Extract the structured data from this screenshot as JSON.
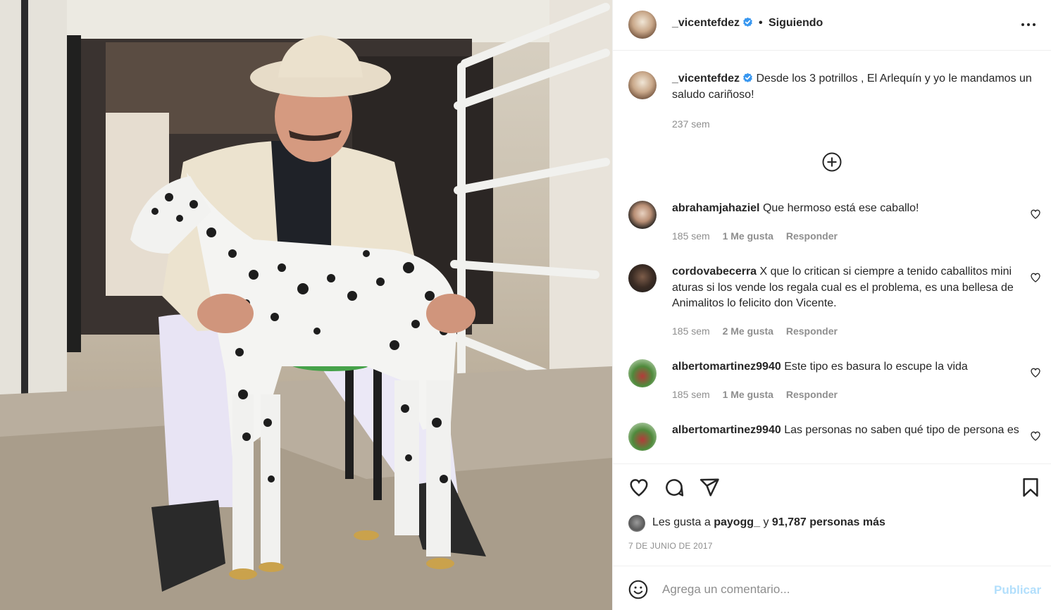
{
  "header": {
    "username": "_vicentefdez",
    "separator": "•",
    "follow_status": "Siguiendo"
  },
  "caption": {
    "username": "_vicentefdez",
    "text": "Desde los 3 potrillos , El Arlequín y yo le mandamos un saludo cariñoso!",
    "time": "237 sem"
  },
  "comments": [
    {
      "username": "abrahamjahaziel",
      "text": "Que hermoso está ese caballo!",
      "time": "185 sem",
      "likes": "1 Me gusta",
      "reply": "Responder"
    },
    {
      "username": "cordovabecerra",
      "text": "X que lo critican si ciempre a tenido caballitos mini aturas si los vende los regala cual es el problema, es una bellesa de Animalitos lo felicito don Vicente.",
      "time": "185 sem",
      "likes": "2 Me gusta",
      "reply": "Responder"
    },
    {
      "username": "albertomartinez9940",
      "text": "Este tipo es basura lo escupe la vida",
      "time": "185 sem",
      "likes": "1 Me gusta",
      "reply": "Responder"
    },
    {
      "username": "albertomartinez9940",
      "text": "Las personas no saben qué tipo de persona es"
    }
  ],
  "likes": {
    "prefix": "Les gusta a",
    "user": "payogg_",
    "joiner": "y",
    "count_text": "91,787 personas más"
  },
  "date": "7 DE JUNIO DE 2017",
  "add_comment": {
    "placeholder": "Agrega un comentario...",
    "publish_label": "Publicar"
  },
  "colors": {
    "verified": "#3897f0",
    "publish_disabled": "#b2dffc",
    "meta": "#8e8e8e"
  },
  "icons": [
    "verified-badge-icon",
    "more-options-icon",
    "plus-circle-icon",
    "heart-icon",
    "comment-icon",
    "share-icon",
    "bookmark-icon",
    "emoji-icon"
  ]
}
